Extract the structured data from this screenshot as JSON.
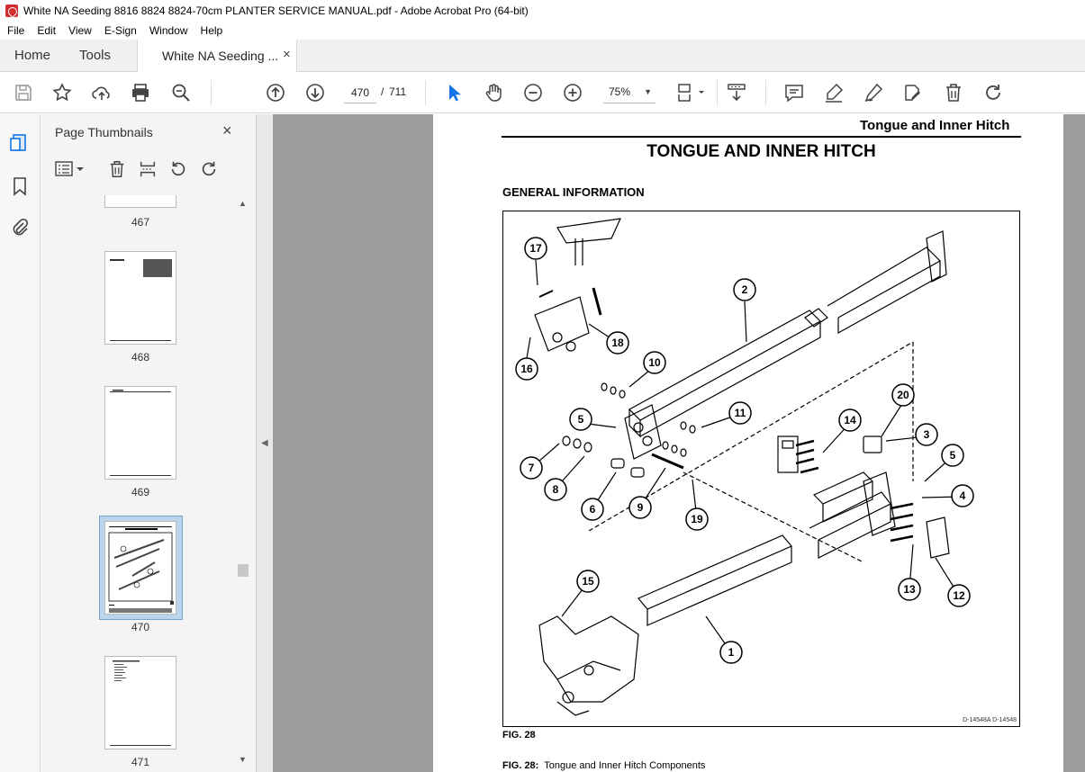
{
  "window": {
    "title": "White NA Seeding 8816  8824  8824-70cm PLANTER SERVICE MANUAL.pdf - Adobe Acrobat Pro (64-bit)"
  },
  "menu": {
    "items": [
      "File",
      "Edit",
      "View",
      "E-Sign",
      "Window",
      "Help"
    ]
  },
  "tabs": {
    "home": "Home",
    "tools": "Tools",
    "doc": "White NA Seeding ...",
    "close": "×"
  },
  "toolbar": {
    "page_current": "470",
    "page_sep": "/",
    "page_total": "711",
    "zoom": "75%"
  },
  "panel": {
    "title": "Page Thumbnails",
    "close": "×",
    "thumbnails": [
      {
        "page": "467"
      },
      {
        "page": "468"
      },
      {
        "page": "469"
      },
      {
        "page": "470",
        "selected": true
      },
      {
        "page": "471"
      }
    ]
  },
  "document": {
    "header": "Tongue and Inner Hitch",
    "title": "TONGUE AND INNER HITCH",
    "section": "GENERAL INFORMATION",
    "figure_code": "D-14548A  D-14548",
    "figure_label": "FIG. 28",
    "caption_prefix": "FIG. 28:",
    "caption_text": "Tongue and Inner Hitch Components",
    "callouts": [
      "17",
      "2",
      "18",
      "16",
      "10",
      "11",
      "5",
      "20",
      "14",
      "3",
      "7",
      "5",
      "8",
      "6",
      "9",
      "19",
      "4",
      "13",
      "12",
      "15",
      "1"
    ]
  },
  "colors": {
    "accent": "#1473e6",
    "selection": "#bcd4ec",
    "doc_bg": "#9c9c9c"
  }
}
